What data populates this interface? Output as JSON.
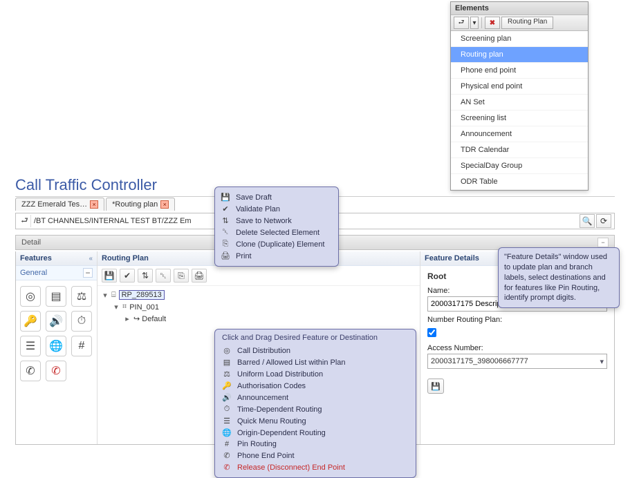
{
  "elements_panel": {
    "title": "Elements",
    "toolbar_label": "Routing Plan",
    "items": [
      "Screening plan",
      "Routing plan",
      "Phone end point",
      "Physical end point",
      "AN Set",
      "Screening list",
      "Announcement",
      "TDR Calendar",
      "SpecialDay Group",
      "ODR Table"
    ],
    "selected_index": 1
  },
  "app_title": "Call Traffic Controller",
  "tabs": [
    {
      "label": "ZZZ Emerald Tes…"
    },
    {
      "label": "*Routing plan"
    }
  ],
  "crumb_path": "/BT CHANNELS/INTERNAL TEST BT/ZZZ Em",
  "detail_label": "Detail",
  "columns": {
    "features_title": "Features",
    "features_group": "General",
    "routing_plan_title": "Routing Plan",
    "feature_details_title": "Feature Details"
  },
  "tree": {
    "root": "RP_289513",
    "child": "PIN_001",
    "leaf": "↪ Default"
  },
  "fd": {
    "root_label": "Root",
    "name_label": "Name:",
    "name_value": "2000317175 Description",
    "nrp_label": "Number Routing Plan:",
    "nrp_checked": true,
    "access_label": "Access Number:",
    "access_value": "2000317175_398006667777"
  },
  "popup_toolbar": {
    "items": [
      {
        "icon": "💾",
        "label": "Save Draft"
      },
      {
        "icon": "✔",
        "label": "Validate Plan"
      },
      {
        "icon": "⇅",
        "label": "Save to Network"
      },
      {
        "icon": "␡",
        "label": "Delete Selected Element"
      },
      {
        "icon": "⎘",
        "label": "Clone (Duplicate) Element"
      },
      {
        "icon": "🖨",
        "label": "Print"
      }
    ]
  },
  "popup_features": {
    "header": "Click and Drag Desired Feature or Destination",
    "items": [
      {
        "icon": "◎",
        "label": "Call Distribution"
      },
      {
        "icon": "▤",
        "label": "Barred / Allowed List within Plan"
      },
      {
        "icon": "⚖",
        "label": "Uniform Load Distribution"
      },
      {
        "icon": "🔑",
        "label": "Authorisation Codes"
      },
      {
        "icon": "🔊",
        "label": "Announcement"
      },
      {
        "icon": "⏱",
        "label": "Time-Dependent Routing"
      },
      {
        "icon": "☰",
        "label": "Quick Menu Routing"
      },
      {
        "icon": "🌐",
        "label": "Origin-Dependent Routing"
      },
      {
        "icon": "#",
        "label": "Pin Routing"
      },
      {
        "icon": "✆",
        "label": "Phone End Point"
      },
      {
        "icon": "✆",
        "label": "Release (Disconnect) End Point",
        "red": true
      }
    ]
  },
  "popup_fd_tip": "\"Feature Details\" window used to update plan and branch labels, select destinations and for features like Pin Routing, identify prompt digits."
}
